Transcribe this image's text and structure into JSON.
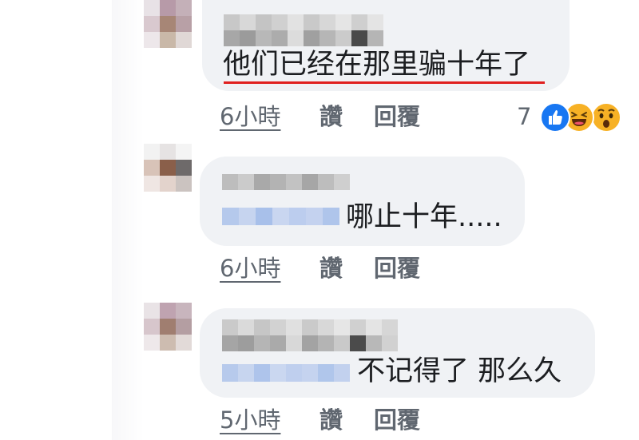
{
  "comments": [
    {
      "text": "他们已经在那里骗十年了",
      "time": "6小時",
      "like": "讚",
      "reply": "回覆",
      "reaction_count": "7",
      "reactions": [
        "like-icon",
        "laugh-icon",
        "wow-icon"
      ]
    },
    {
      "text": "哪止十年.....",
      "time": "6小時",
      "like": "讚",
      "reply": "回覆"
    },
    {
      "text": "不记得了 那么久",
      "time": "5小時",
      "like": "讚",
      "reply": "回覆"
    }
  ],
  "colors": {
    "bubble": "#f0f2f5",
    "underline": "#e0201f",
    "like_blue": "#1877f2",
    "emoji_yellow": "#f7b125"
  }
}
